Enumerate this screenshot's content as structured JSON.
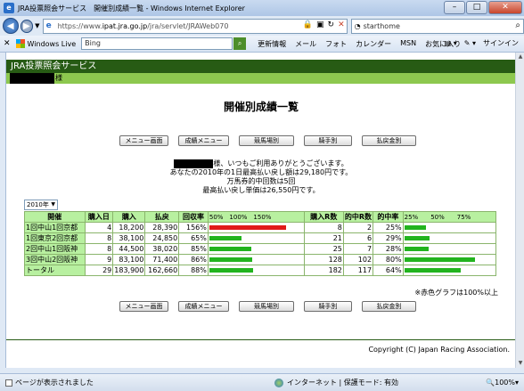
{
  "window": {
    "title": "JRA投票照会サービス　開催別成績一覧 - Windows Internet Explorer",
    "min": "–",
    "max": "□",
    "close": "✕"
  },
  "address": {
    "url_prefix": "https://www.",
    "url_host": "ipat.jra.go.jp",
    "url_path": "/jra/servlet/JRAWeb070",
    "search_text": "starthome"
  },
  "favbar": {
    "windows_live": "Windows Live",
    "bing": "Bing",
    "links": [
      "更新情報",
      "メール",
      "フォト",
      "カレンダー",
      "MSN",
      "お気に入り"
    ],
    "signin": "サインイン"
  },
  "page": {
    "service_title": "JRA投票照会サービス",
    "user_suffix": "様",
    "heading": "開催別成績一覧",
    "buttons": [
      "メニュー画面",
      "成績メニュー",
      "競馬場別",
      "騎手別",
      "払戻金別"
    ],
    "msg_line1": "様、いつもご利用ありがとうございます。",
    "msg_line2": "あなたの2010年の1日最高払い戻し額は29,180円です。",
    "msg_line3": "万馬券的中回数は5回",
    "msg_line4": "最高払い戻し単価は26,550円です。",
    "year": "2010年",
    "table": {
      "headers": [
        "開催",
        "購入日",
        "購入",
        "払戻",
        "回収率",
        "50%　100%　150%",
        "購入R数",
        "的中R数",
        "的中率",
        "25%　　50%　　75%"
      ],
      "rows": [
        {
          "name": "1回中山1回京都",
          "days": "4",
          "buy": "18,200",
          "pay": "28,390",
          "rate": "156%",
          "rate_val": 156,
          "races": "8",
          "hits": "2",
          "hitrate": "25%",
          "hit_val": 25,
          "red": true
        },
        {
          "name": "1回東京2回京都",
          "days": "8",
          "buy": "38,100",
          "pay": "24,850",
          "rate": "65%",
          "rate_val": 65,
          "races": "21",
          "hits": "6",
          "hitrate": "29%",
          "hit_val": 29,
          "red": false
        },
        {
          "name": "2回中山1回阪神",
          "days": "8",
          "buy": "44,500",
          "pay": "38,020",
          "rate": "85%",
          "rate_val": 85,
          "races": "25",
          "hits": "7",
          "hitrate": "28%",
          "hit_val": 28,
          "red": false
        },
        {
          "name": "3回中山2回阪神",
          "days": "9",
          "buy": "83,100",
          "pay": "71,400",
          "rate": "86%",
          "rate_val": 86,
          "races": "128",
          "hits": "102",
          "hitrate": "80%",
          "hit_val": 80,
          "red": false
        },
        {
          "name": "トータル",
          "days": "29",
          "buy": "183,900",
          "pay": "162,660",
          "rate": "88%",
          "rate_val": 88,
          "races": "182",
          "hits": "117",
          "hitrate": "64%",
          "hit_val": 64,
          "red": false
        }
      ]
    },
    "note": "※赤色グラフは100%以上",
    "copyright": "Copyright (C) Japan Racing Association."
  },
  "status": {
    "left": "ページが表示されました",
    "zone": "インターネット | 保護モード: 有効",
    "zoom": "100%"
  },
  "colors": {
    "bar_green": "#22b41e",
    "bar_red": "#e01a1a",
    "header_green": "#275b14",
    "light_green": "#8dc84f"
  }
}
